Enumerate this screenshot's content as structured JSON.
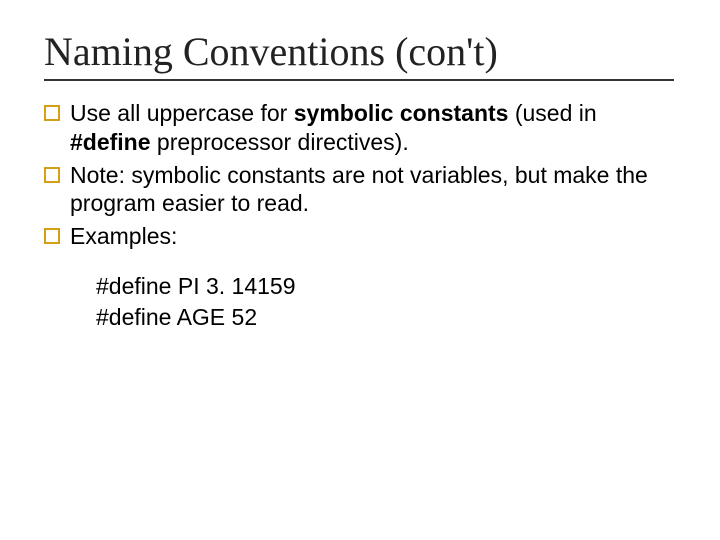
{
  "title": "Naming Conventions (con't)",
  "bullets": [
    {
      "pre": "Use all uppercase for ",
      "b1": "symbolic constants",
      "mid": " (used in ",
      "b2": "#define",
      "post": " preprocessor directives)."
    },
    {
      "text": "Note:  symbolic constants are not variables, but make the program easier to read."
    },
    {
      "text": "Examples:"
    }
  ],
  "examples": [
    "#define PI 3. 14159",
    "#define AGE  52"
  ]
}
